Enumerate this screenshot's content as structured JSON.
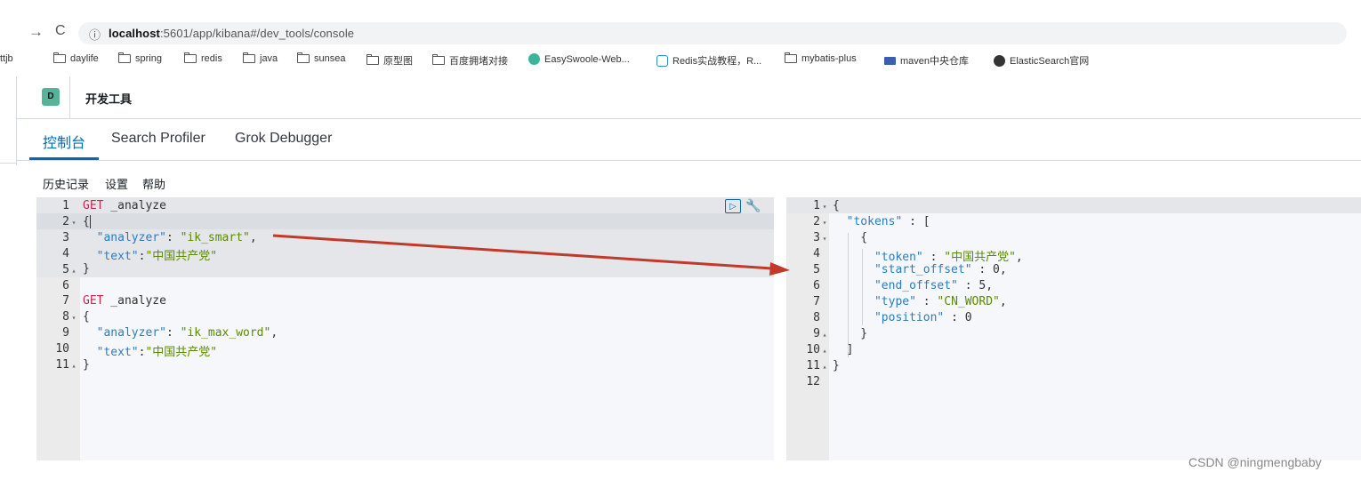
{
  "browser": {
    "back_icon": "→",
    "reload_icon": "C",
    "info_icon": "ⓘ",
    "url_host": "localhost",
    "url_rest": ":5601/app/kibana#/dev_tools/console",
    "bookmarks": [
      "ttjb",
      "daylife",
      "spring",
      "redis",
      "java",
      "sunsea",
      "原型图",
      "百度拥堵对接",
      "EasySwoole-Web...",
      "Redis实战教程，R...",
      "mybatis-plus",
      "maven中央仓库",
      "ElasticSearch官网"
    ]
  },
  "header": {
    "logo_letter": "D",
    "title": "开发工具"
  },
  "tabs": [
    "控制台",
    "Search Profiler",
    "Grok Debugger"
  ],
  "menu": [
    "历史记录",
    "设置",
    "帮助"
  ],
  "request": {
    "line_numbers": [
      "1",
      "2",
      "3",
      "4",
      "5",
      "6",
      "7",
      "8",
      "9",
      "10",
      "11"
    ],
    "fold_markers": [
      "",
      "▾",
      "",
      "",
      "▴",
      "",
      "",
      "▾",
      "",
      "",
      "▴"
    ]
  },
  "response": {
    "line_numbers": [
      "1",
      "2",
      "3",
      "4",
      "5",
      "6",
      "7",
      "8",
      "9",
      "10",
      "11",
      "12"
    ],
    "fold_markers": [
      "▾",
      "▾",
      "▾",
      "",
      "",
      "",
      "",
      "",
      "▴",
      "▴",
      "▴",
      ""
    ]
  },
  "watermark": "CSDN @ningmengbaby",
  "colors": {
    "accent": "#006bb4",
    "arrow": "#c0392b",
    "logo": "#54b399"
  }
}
